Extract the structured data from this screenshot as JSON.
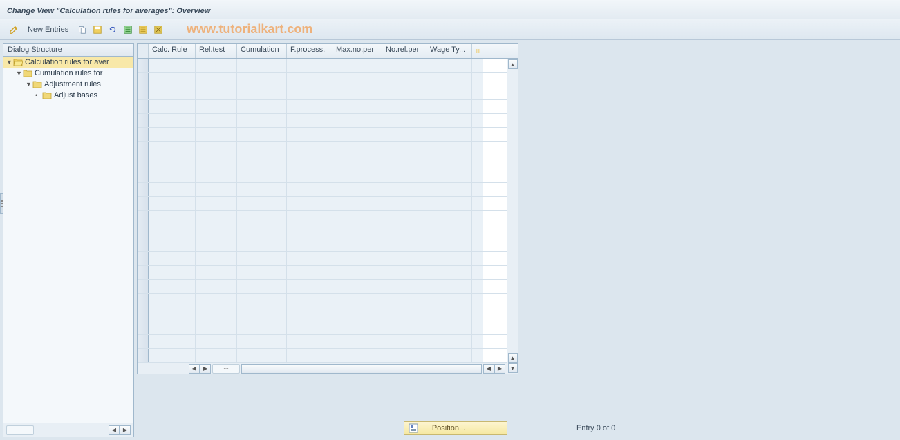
{
  "title": "Change View \"Calculation rules for averages\": Overview",
  "toolbar": {
    "new_entries": "New Entries"
  },
  "watermark": "www.tutorialkart.com",
  "sidebar": {
    "header": "Dialog Structure",
    "items": [
      {
        "indent": 0,
        "expanded": true,
        "open": true,
        "label": "Calculation rules for aver",
        "selected": true
      },
      {
        "indent": 1,
        "expanded": true,
        "open": false,
        "label": "Cumulation rules for",
        "selected": false
      },
      {
        "indent": 2,
        "expanded": true,
        "open": false,
        "label": "Adjustment rules",
        "selected": false
      },
      {
        "indent": 3,
        "expanded": false,
        "open": false,
        "label": "Adjust bases",
        "selected": false,
        "leaf": true
      }
    ]
  },
  "table": {
    "columns": [
      "Calc. Rule",
      "Rel.test",
      "Cumulation",
      "F.process.",
      "Max.no.per",
      "No.rel.per",
      "Wage Ty..."
    ],
    "row_count": 22
  },
  "footer": {
    "position_label": "Position...",
    "entry_text": "Entry 0 of 0"
  }
}
